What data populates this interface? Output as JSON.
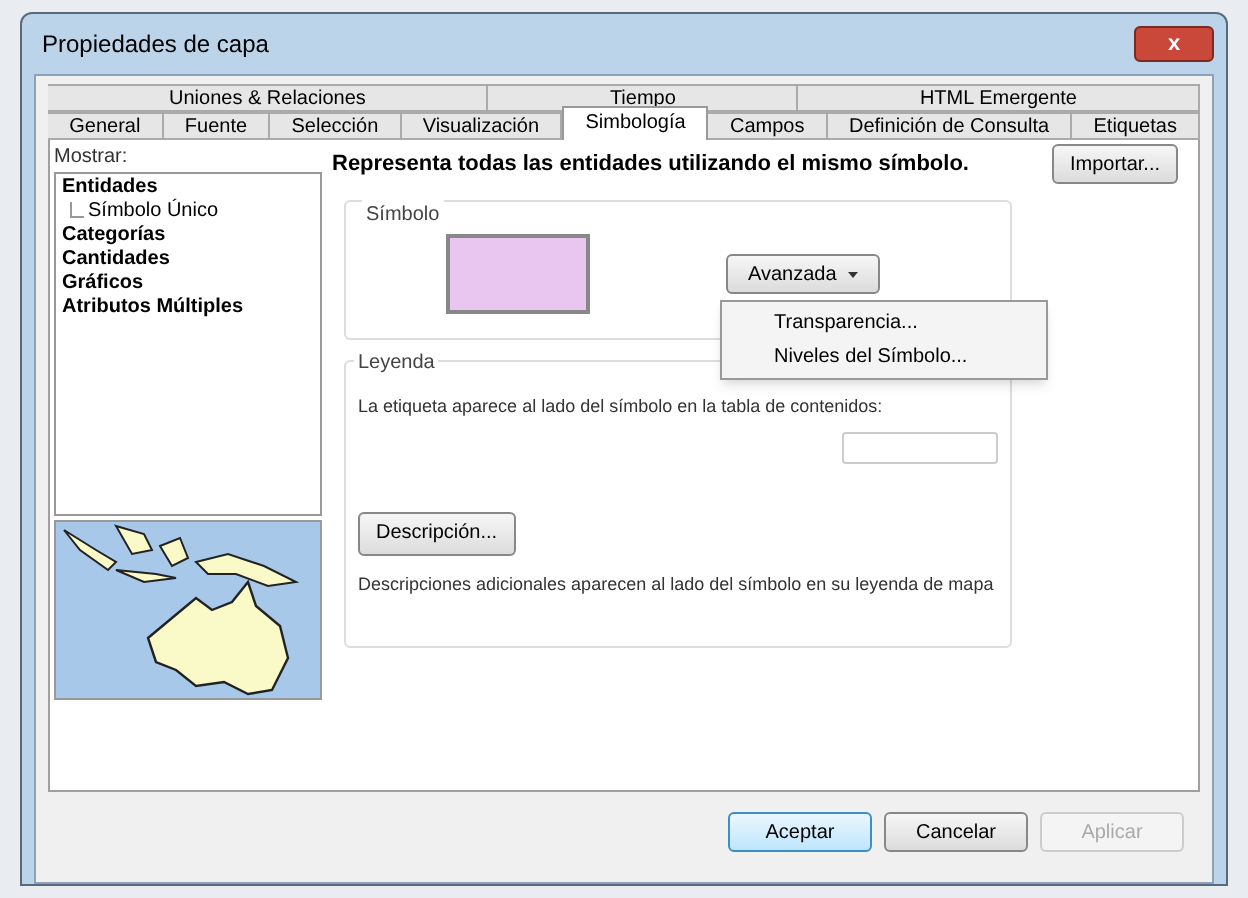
{
  "window": {
    "title": "Propiedades de capa",
    "close_label": "x"
  },
  "back_tabs": [
    {
      "label": "Uniones & Relaciones",
      "selected": false
    },
    {
      "label": "Tiempo",
      "selected": false
    },
    {
      "label": "HTML Emergente",
      "selected": false
    }
  ],
  "front_tabs": [
    {
      "label": "General",
      "selected": false
    },
    {
      "label": "Fuente",
      "selected": false
    },
    {
      "label": "Selección",
      "selected": false
    },
    {
      "label": "Visualización",
      "selected": false
    },
    {
      "label": "Simbología",
      "selected": true
    },
    {
      "label": "Campos",
      "selected": false
    },
    {
      "label": "Definición de Consulta",
      "selected": false
    },
    {
      "label": "Etiquetas",
      "selected": false
    }
  ],
  "show_panel": {
    "label": "Mostrar:",
    "items": [
      {
        "label": "Entidades",
        "children": [
          {
            "label": "Símbolo Único"
          }
        ]
      },
      {
        "label": "Categorías"
      },
      {
        "label": "Cantidades"
      },
      {
        "label": "Gráficos"
      },
      {
        "label": "Atributos Múltiples"
      }
    ]
  },
  "content": {
    "heading": "Representa todas las entidades utilizando el mismo símbolo.",
    "import_button": "Importar...",
    "symbol": {
      "title": "Símbolo",
      "color": "#e8c6f0",
      "advanced_button": "Avanzada",
      "menu": [
        "Transparencia...",
        "Niveles del Símbolo..."
      ]
    },
    "legend": {
      "title": "Leyenda",
      "label_text": "La etiqueta aparece al lado del símbolo en la tabla de contenidos:",
      "description_button": "Descripción...",
      "description_text": "Descripciones adicionales aparecen al lado del símbolo en su leyenda de mapa"
    }
  },
  "buttons": [
    {
      "label": "Aceptar",
      "disabled": false,
      "default": true
    },
    {
      "label": "Cancelar",
      "disabled": false,
      "default": false
    },
    {
      "label": "Aplicar",
      "disabled": true,
      "default": false
    }
  ]
}
